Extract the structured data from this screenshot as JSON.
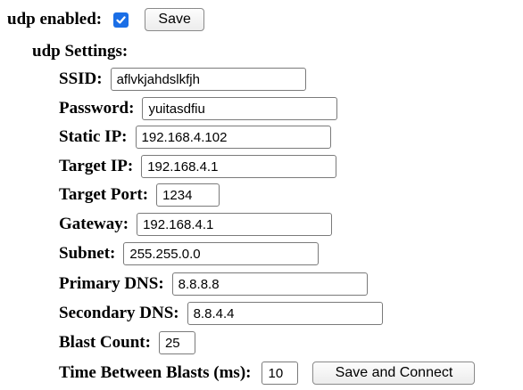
{
  "udp": {
    "enabled_label": "udp enabled:",
    "enabled": true,
    "save_label": "Save"
  },
  "settings": {
    "title": "udp Settings:",
    "fields": [
      {
        "label": "SSID:",
        "value": "aflvkjahdslkfjh"
      },
      {
        "label": "Password:",
        "value": "yuitasdfiu"
      },
      {
        "label": "Static IP:",
        "value": "192.168.4.102"
      },
      {
        "label": "Target IP:",
        "value": "192.168.4.1"
      },
      {
        "label": "Target Port:",
        "value": "1234"
      },
      {
        "label": "Gateway:",
        "value": "192.168.4.1"
      },
      {
        "label": "Subnet:",
        "value": "255.255.0.0"
      },
      {
        "label": "Primary DNS:",
        "value": "8.8.8.8"
      },
      {
        "label": "Secondary DNS:",
        "value": "8.8.4.4"
      },
      {
        "label": "Blast Count:",
        "value": "25"
      },
      {
        "label": "Time Between Blasts (ms):",
        "value": "10"
      }
    ],
    "save_connect_label": "Save and Connect"
  },
  "colors": {
    "checkbox_accent": "#1a6ee6",
    "field_border": "#7a7a7a"
  }
}
